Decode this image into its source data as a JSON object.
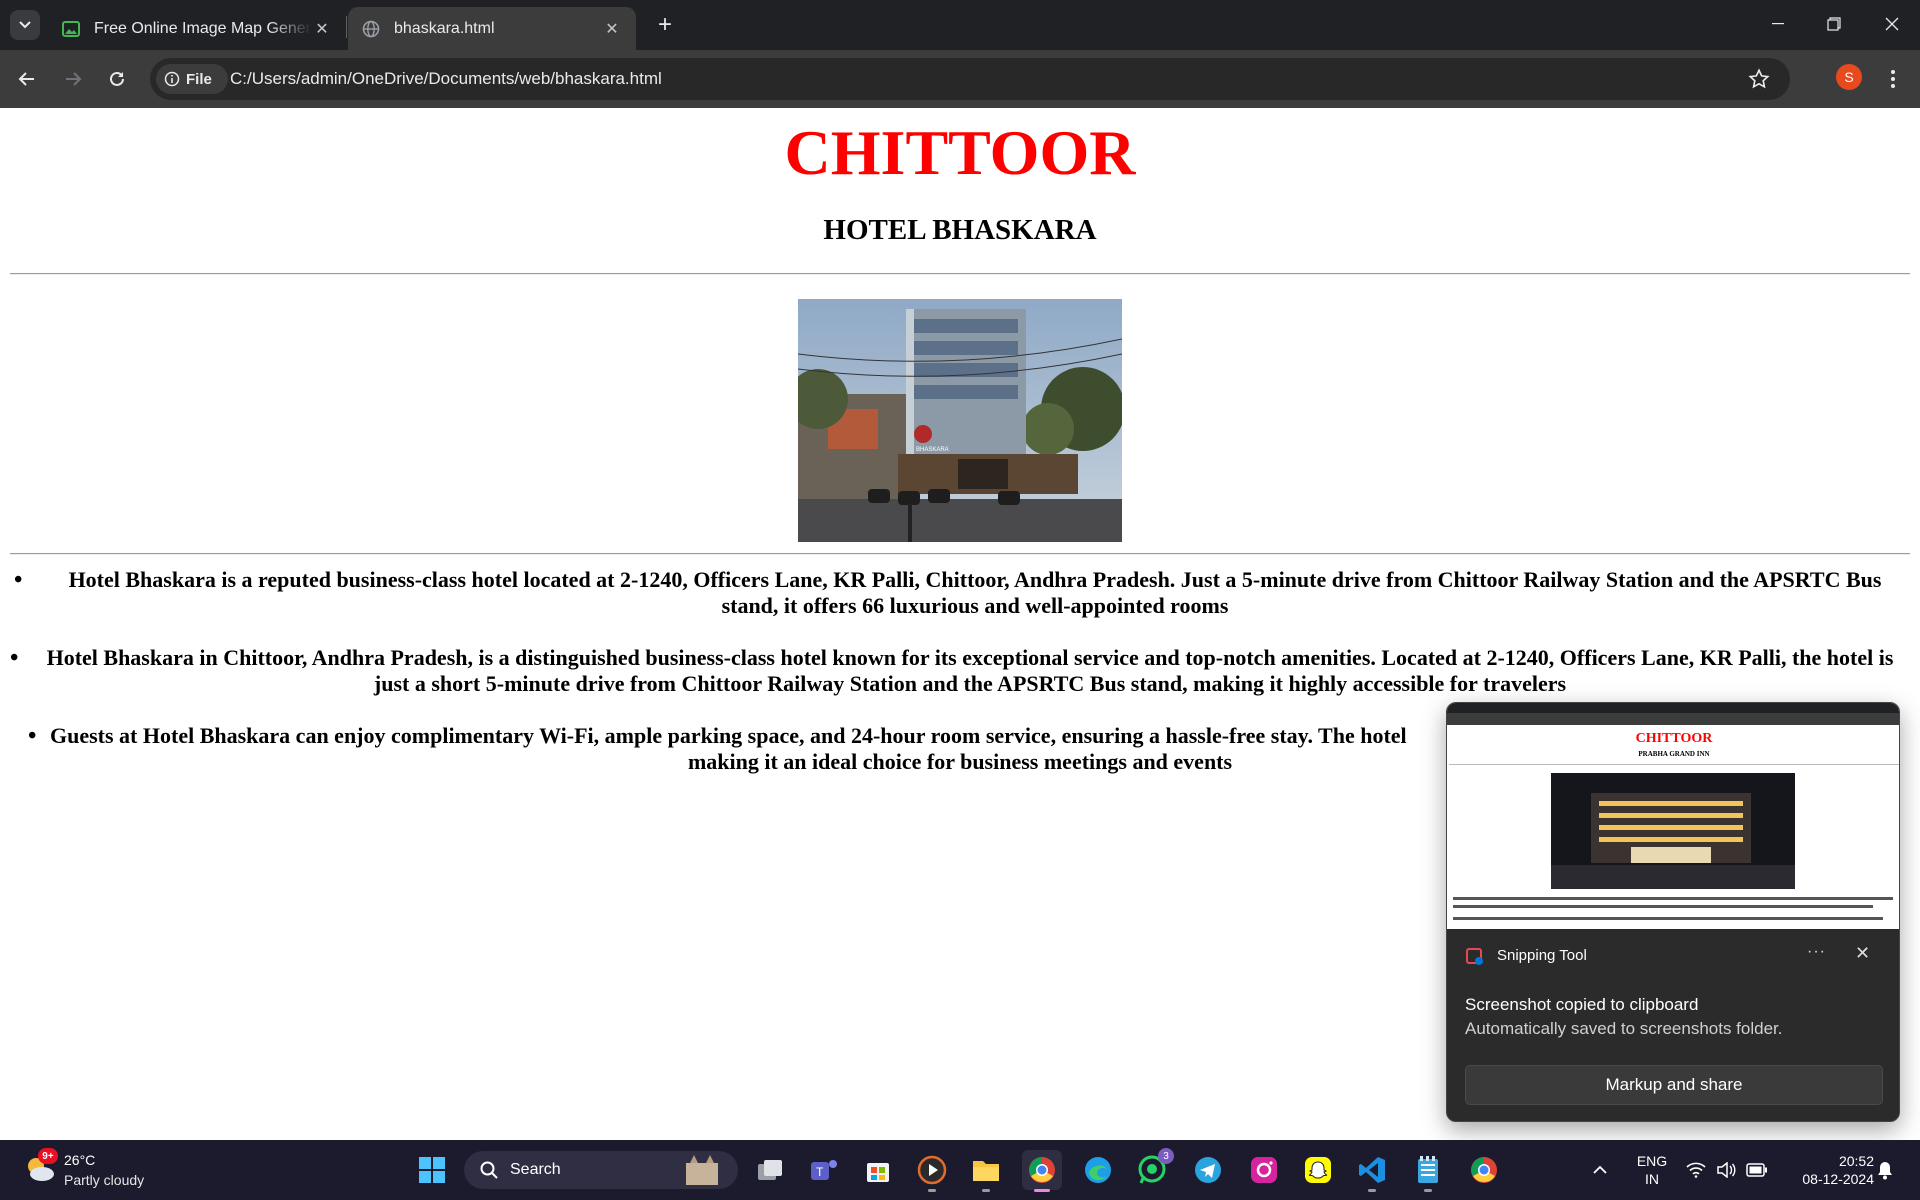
{
  "browser": {
    "tabs": [
      {
        "title": "Free Online Image Map Genera",
        "active": false
      },
      {
        "title": "bhaskara.html",
        "active": true
      }
    ],
    "omnibox": {
      "chip_label": "File",
      "url": "C:/Users/admin/OneDrive/Documents/web/bhaskara.html"
    },
    "profile_initial": "S"
  },
  "page": {
    "city": "CHITTOOR",
    "hotel": "HOTEL BHASKARA",
    "bullets": [
      "Hotel Bhaskara is a reputed business-class hotel located at 2-1240, Officers Lane, KR Palli, Chittoor, Andhra Pradesh. Just a 5-minute drive from Chittoor Railway Station and the APSRTC Bus stand, it offers 66 luxurious and well-appointed rooms",
      "Hotel Bhaskara in Chittoor, Andhra Pradesh, is a distinguished business-class hotel known for its exceptional service and top-notch amenities. Located at 2-1240, Officers Lane, KR Palli, the hotel is just a short 5-minute drive from Chittoor Railway Station and the APSRTC Bus stand, making it highly accessible for travelers",
      "Guests at Hotel Bhaskara can enjoy complimentary Wi-Fi, ample parking space, and 24-hour room service, ensuring a hassle-free stay. The hotel",
      "making it an ideal choice for business meetings and events"
    ],
    "photo_sign": "BHASKARA"
  },
  "toast": {
    "thumb_city": "CHITTOOR",
    "thumb_hotel": "PRABHA GRAND INN",
    "app_name": "Snipping Tool",
    "more": "···",
    "heading": "Screenshot copied to clipboard",
    "body": "Automatically saved to screenshots folder.",
    "button": "Markup and share"
  },
  "taskbar": {
    "weather": {
      "temp": "26°C",
      "condition": "Partly cloudy",
      "badge": "9+"
    },
    "search_label": "Search",
    "whatsapp_badge": "3",
    "lang_line1": "ENG",
    "lang_line2": "IN",
    "time": "20:52",
    "date": "08-12-2024"
  },
  "colors": {
    "heading_red": "#ff0000",
    "tab_bar": "#202124",
    "toolbar": "#3c3c3c",
    "taskbar": "#1c1b2e",
    "avatar": "#e8491d"
  }
}
